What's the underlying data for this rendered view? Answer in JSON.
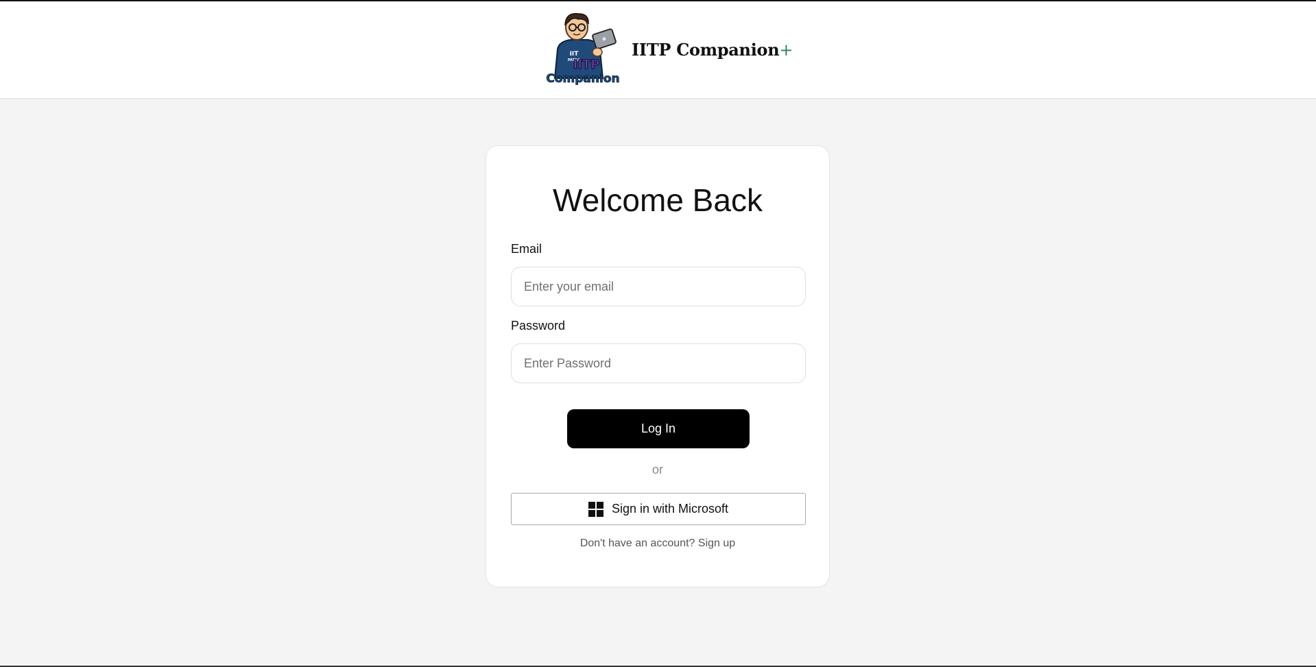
{
  "header": {
    "brand_name": "IITP Companion",
    "brand_suffix": "+",
    "logo": {
      "icon": "mascot-with-laptop-logo",
      "text_top": "IIT",
      "text_sub": "PATNA",
      "text_mid": "IITP",
      "text_bottom": "Companion"
    }
  },
  "login": {
    "title": "Welcome Back",
    "email_label": "Email",
    "email_placeholder": "Enter your email",
    "email_value": "",
    "password_label": "Password",
    "password_placeholder": "Enter Password",
    "password_value": "",
    "login_button": "Log In",
    "divider": "or",
    "microsoft_button": "Sign in with Microsoft",
    "microsoft_icon": "windows-logo-icon",
    "signup_prompt": "Don't have an account?",
    "signup_link": "Sign up"
  },
  "colors": {
    "page_background": "#f4f4f4",
    "card_background": "#ffffff",
    "primary_button": "#000000",
    "brand_plus": "#2e7d5b"
  }
}
